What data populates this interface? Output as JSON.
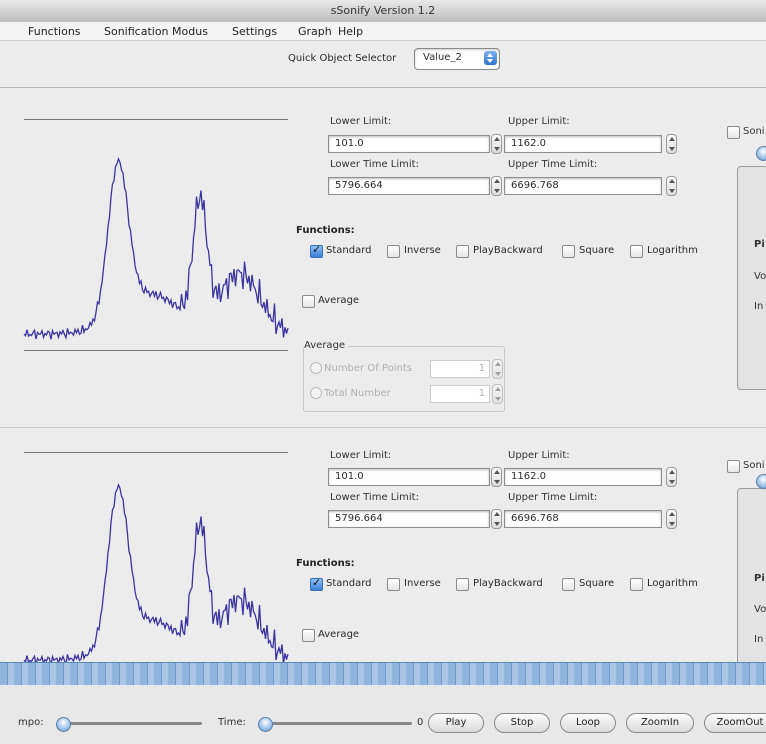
{
  "window": {
    "title": "sSonify Version 1.2"
  },
  "menu": [
    "Functions",
    "Sonification Modus",
    "Settings",
    "Graph",
    "Help"
  ],
  "toolbar": {
    "quick_object_label": "Quick Object Selector",
    "quick_object_value": "Value_2"
  },
  "panels": [
    {
      "lower_limit_label": "Lower Limit:",
      "lower_limit": "101.0",
      "upper_limit_label": "Upper Limit:",
      "upper_limit": "1162.0",
      "lower_time_label": "Lower Time Limit:",
      "lower_time": "5796.664",
      "upper_time_label": "Upper Time Limit:",
      "upper_time": "6696.768",
      "functions_label": "Functions:",
      "functions": [
        {
          "label": "Standard",
          "checked": true
        },
        {
          "label": "Inverse",
          "checked": false
        },
        {
          "label": "PlayBackward",
          "checked": false
        },
        {
          "label": "Square",
          "checked": false
        },
        {
          "label": "Logarithm",
          "checked": false
        }
      ],
      "average_label": "Average",
      "average_group_title": "Average",
      "number_of_points_label": "Number Of Points",
      "number_of_points": "1",
      "total_number_label": "Total Number",
      "total_number": "1",
      "side_checkbox_label": "Soni",
      "side_labels": [
        "Pi",
        "Vo",
        "In"
      ]
    },
    {
      "lower_limit_label": "Lower Limit:",
      "lower_limit": "101.0",
      "upper_limit_label": "Upper Limit:",
      "upper_limit": "1162.0",
      "lower_time_label": "Lower Time Limit:",
      "lower_time": "5796.664",
      "upper_time_label": "Upper Time Limit:",
      "upper_time": "6696.768",
      "functions_label": "Functions:",
      "functions": [
        {
          "label": "Standard",
          "checked": true
        },
        {
          "label": "Inverse",
          "checked": false
        },
        {
          "label": "PlayBackward",
          "checked": false
        },
        {
          "label": "Square",
          "checked": false
        },
        {
          "label": "Logarithm",
          "checked": false
        }
      ],
      "average_label": "Average",
      "side_checkbox_label": "Soni",
      "side_labels": [
        "Pi",
        "Vo",
        "In"
      ]
    }
  ],
  "bottom": {
    "tempo_label": "mpo:",
    "time_label": "Time:",
    "time_value": "0",
    "buttons": [
      "Play",
      "Stop",
      "Loop",
      "ZoomIn",
      "ZoomOut"
    ]
  },
  "colors": {
    "graph_line": "#3b34a0",
    "accent": "#3a7fd7"
  }
}
